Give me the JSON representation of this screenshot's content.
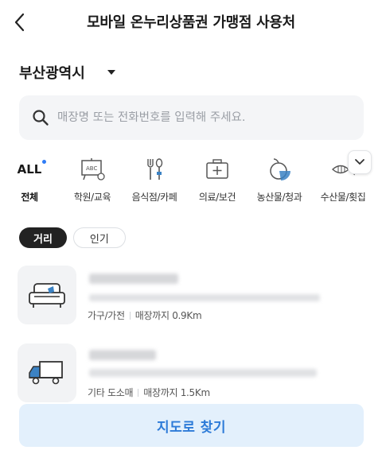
{
  "header": {
    "title": "모바일 온누리상품권 가맹점 사용처",
    "back_icon": "chevron-left-icon"
  },
  "region": {
    "label": "부산광역시",
    "caret_icon": "caret-down-icon"
  },
  "search": {
    "placeholder": "매장명 또는 전화번호를 입력해 주세요.",
    "value": "",
    "icon": "search-icon"
  },
  "categories": [
    {
      "label": "전체",
      "icon_text": "ALL",
      "icon": "all-icon",
      "selected": true
    },
    {
      "label": "학원/교육",
      "icon": "blackboard-icon"
    },
    {
      "label": "음식점/카페",
      "icon": "cutlery-icon"
    },
    {
      "label": "의료/보건",
      "icon": "first-aid-kit-icon"
    },
    {
      "label": "농산물/청과",
      "icon": "fruit-icon"
    },
    {
      "label": "수산물/횟집",
      "icon": "fish-icon"
    }
  ],
  "sort": {
    "options": [
      "거리",
      "인기"
    ],
    "selected": "거리"
  },
  "stores": [
    {
      "icon": "sofa-icon",
      "category": "가구/가전",
      "distance": "매장까지 0.9Km"
    },
    {
      "icon": "truck-icon",
      "category": "기타 도소매",
      "distance": "매장까지 1.5Km"
    }
  ],
  "map_button": {
    "label": "지도로 찾기"
  },
  "colors": {
    "accent": "#2d7bd8",
    "accent_bg": "#e3f0fc",
    "chip_active": "#222222",
    "icon_blue": "#3b82c4"
  }
}
